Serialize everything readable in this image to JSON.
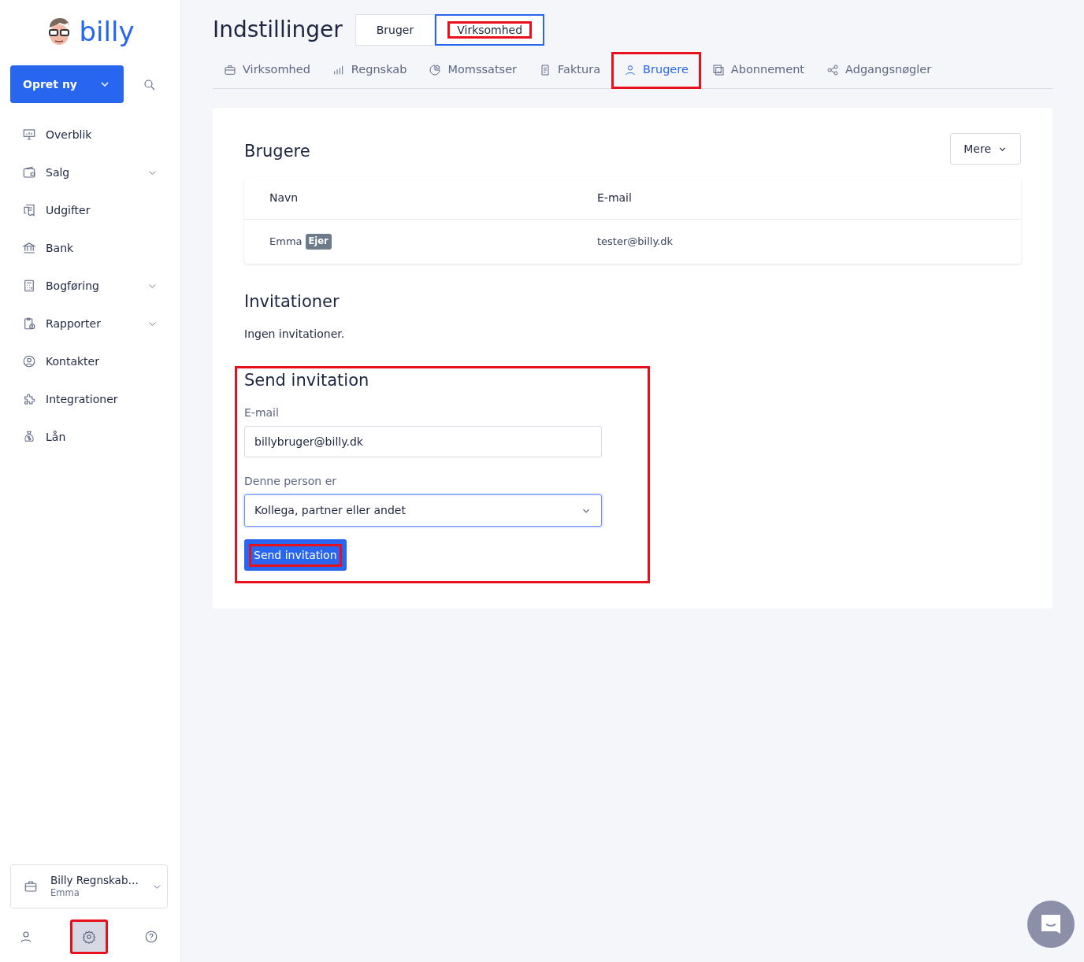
{
  "sidebar": {
    "logo": "billy",
    "create_button": "Opret ny",
    "items": [
      {
        "label": "Overblik",
        "expandable": false
      },
      {
        "label": "Salg",
        "expandable": true
      },
      {
        "label": "Udgifter",
        "expandable": false
      },
      {
        "label": "Bank",
        "expandable": false
      },
      {
        "label": "Bogføring",
        "expandable": true
      },
      {
        "label": "Rapporter",
        "expandable": true
      },
      {
        "label": "Kontakter",
        "expandable": false
      },
      {
        "label": "Integrationer",
        "expandable": false
      },
      {
        "label": "Lån",
        "expandable": false
      }
    ],
    "account": {
      "name": "Billy Regnskab…",
      "user": "Emma"
    },
    "footer_buttons": [
      {
        "selected": false,
        "highlighted": false
      },
      {
        "selected": true,
        "highlighted": true
      },
      {
        "selected": false,
        "highlighted": false
      }
    ]
  },
  "header": {
    "title": "Indstillinger",
    "scope_toggle": [
      {
        "label": "Bruger",
        "selected": false,
        "highlighted": false
      },
      {
        "label": "Virksomhed",
        "selected": true,
        "highlighted": true
      }
    ]
  },
  "tabs": [
    {
      "label": "Virksomhed",
      "selected": false,
      "highlighted": false
    },
    {
      "label": "Regnskab",
      "selected": false,
      "highlighted": false
    },
    {
      "label": "Momssatser",
      "selected": false,
      "highlighted": false
    },
    {
      "label": "Faktura",
      "selected": false,
      "highlighted": false
    },
    {
      "label": "Brugere",
      "selected": true,
      "highlighted": true
    },
    {
      "label": "Abonnement",
      "selected": false,
      "highlighted": false
    },
    {
      "label": "Adgangsnøgler",
      "selected": false,
      "highlighted": false
    }
  ],
  "users": {
    "title": "Brugere",
    "more_button": "Mere",
    "columns": [
      "Navn",
      "E-mail"
    ],
    "rows": [
      {
        "name": "Emma",
        "badge": "Ejer",
        "email": "tester@billy.dk"
      }
    ]
  },
  "invitations": {
    "title": "Invitationer",
    "empty_text": "Ingen invitationer."
  },
  "send_invitation": {
    "highlighted": true,
    "title": "Send invitation",
    "email_label": "E-mail",
    "email_value": "billybruger@billy.dk",
    "role_label": "Denne person er",
    "role_value": "Kollega, partner eller andet",
    "submit": {
      "label": "Send invitation",
      "highlighted": true
    }
  }
}
